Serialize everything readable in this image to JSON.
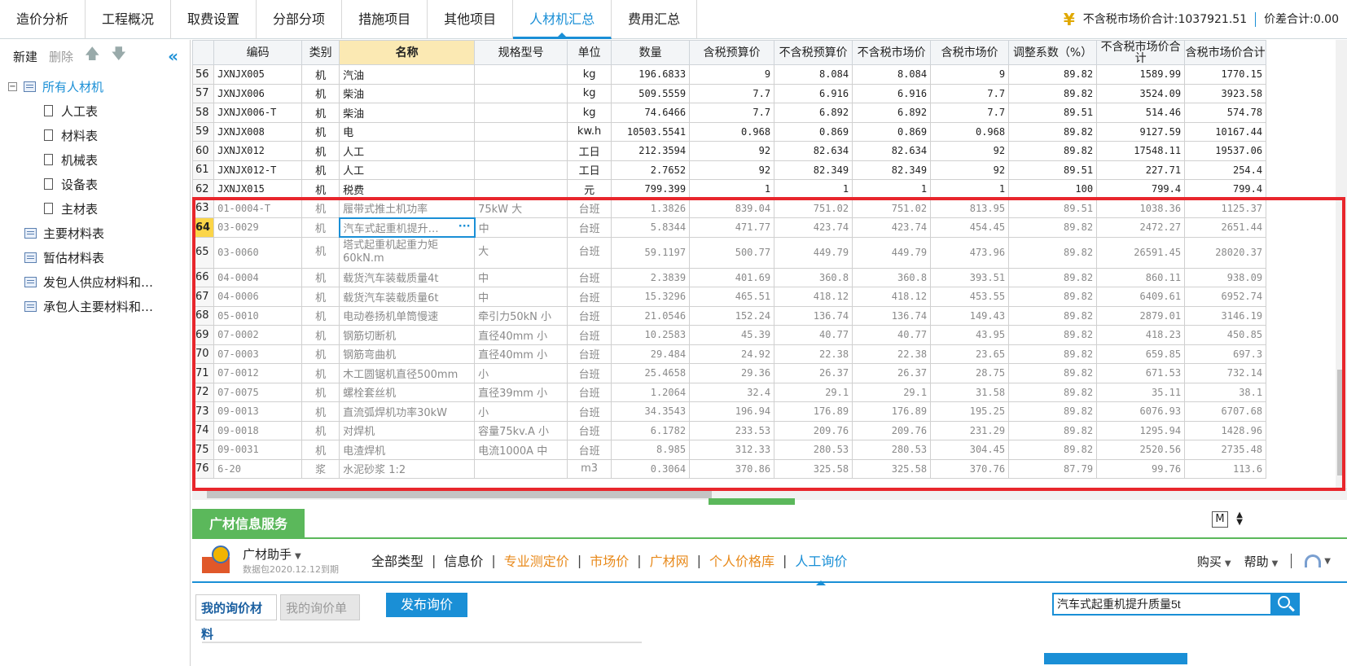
{
  "tabs": [
    "造价分析",
    "工程概况",
    "取费设置",
    "分部分项",
    "措施项目",
    "其他项目",
    "人材机汇总",
    "费用汇总"
  ],
  "active_tab": 6,
  "summary": {
    "market_total_label": "不含税市场价合计:1037921.51",
    "diff_total_label": "价差合计:0.00"
  },
  "left_toolbar": {
    "new": "新建",
    "delete": "删除"
  },
  "tree": {
    "root": "所有人材机",
    "children": [
      "人工表",
      "材料表",
      "机械表",
      "设备表",
      "主材表"
    ],
    "siblings": [
      "主要材料表",
      "暂估材料表",
      "发包人供应材料和…",
      "承包人主要材料和…"
    ]
  },
  "grid": {
    "headers": [
      "",
      "编码",
      "类别",
      "名称",
      "规格型号",
      "单位",
      "数量",
      "含税预算价",
      "不含税预算价",
      "不含税市场价",
      "含税市场价",
      "调整系数（%）",
      "不含税市场价合计",
      "含税市场价合计"
    ],
    "rows": [
      {
        "n": "56",
        "code": "JXNJX005",
        "type": "机",
        "name": "汽油",
        "spec": "",
        "unit": "kg",
        "qty": "196.6833",
        "p1": "9",
        "p2": "8.084",
        "p3": "8.084",
        "p4": "9",
        "coef": "89.82",
        "t1": "1589.99",
        "t2": "1770.15"
      },
      {
        "n": "57",
        "code": "JXNJX006",
        "type": "机",
        "name": "柴油",
        "spec": "",
        "unit": "kg",
        "qty": "509.5559",
        "p1": "7.7",
        "p2": "6.916",
        "p3": "6.916",
        "p4": "7.7",
        "coef": "89.82",
        "t1": "3524.09",
        "t2": "3923.58"
      },
      {
        "n": "58",
        "code": "JXNJX006-T",
        "type": "机",
        "name": "柴油",
        "spec": "",
        "unit": "kg",
        "qty": "74.6466",
        "p1": "7.7",
        "p2": "6.892",
        "p3": "6.892",
        "p4": "7.7",
        "coef": "89.51",
        "t1": "514.46",
        "t2": "574.78"
      },
      {
        "n": "59",
        "code": "JXNJX008",
        "type": "机",
        "name": "电",
        "spec": "",
        "unit": "kw.h",
        "qty": "10503.5541",
        "p1": "0.968",
        "p2": "0.869",
        "p3": "0.869",
        "p4": "0.968",
        "coef": "89.82",
        "t1": "9127.59",
        "t2": "10167.44"
      },
      {
        "n": "60",
        "code": "JXNJX012",
        "type": "机",
        "name": "人工",
        "spec": "",
        "unit": "工日",
        "qty": "212.3594",
        "p1": "92",
        "p2": "82.634",
        "p3": "82.634",
        "p4": "92",
        "coef": "89.82",
        "t1": "17548.11",
        "t2": "19537.06"
      },
      {
        "n": "61",
        "code": "JXNJX012-T",
        "type": "机",
        "name": "人工",
        "spec": "",
        "unit": "工日",
        "qty": "2.7652",
        "p1": "92",
        "p2": "82.349",
        "p3": "82.349",
        "p4": "92",
        "coef": "89.51",
        "t1": "227.71",
        "t2": "254.4"
      },
      {
        "n": "62",
        "code": "JXNJX015",
        "type": "机",
        "name": "税费",
        "spec": "",
        "unit": "元",
        "qty": "799.399",
        "p1": "1",
        "p2": "1",
        "p3": "1",
        "p4": "1",
        "coef": "100",
        "t1": "799.4",
        "t2": "799.4"
      },
      {
        "n": "63",
        "code": "01-0004-T",
        "type": "机",
        "name": "履带式推土机功率",
        "spec": "75kW 大",
        "unit": "台班",
        "qty": "1.3826",
        "p1": "839.04",
        "p2": "751.02",
        "p3": "751.02",
        "p4": "813.95",
        "coef": "89.51",
        "t1": "1038.36",
        "t2": "1125.37"
      },
      {
        "n": "64",
        "code": "03-0029",
        "type": "机",
        "name": "汽车式起重机提升…",
        "spec": "中",
        "unit": "台班",
        "qty": "5.8344",
        "p1": "471.77",
        "p2": "423.74",
        "p3": "423.74",
        "p4": "454.45",
        "coef": "89.82",
        "t1": "2472.27",
        "t2": "2651.44"
      },
      {
        "n": "65",
        "code": "03-0060",
        "type": "机",
        "name": "塔式起重机起重力矩60kN.m",
        "spec": "大",
        "unit": "台班",
        "qty": "59.1197",
        "p1": "500.77",
        "p2": "449.79",
        "p3": "449.79",
        "p4": "473.96",
        "coef": "89.82",
        "t1": "26591.45",
        "t2": "28020.37"
      },
      {
        "n": "66",
        "code": "04-0004",
        "type": "机",
        "name": "载货汽车装载质量4t",
        "spec": "中",
        "unit": "台班",
        "qty": "2.3839",
        "p1": "401.69",
        "p2": "360.8",
        "p3": "360.8",
        "p4": "393.51",
        "coef": "89.82",
        "t1": "860.11",
        "t2": "938.09"
      },
      {
        "n": "67",
        "code": "04-0006",
        "type": "机",
        "name": "载货汽车装载质量6t",
        "spec": "中",
        "unit": "台班",
        "qty": "15.3296",
        "p1": "465.51",
        "p2": "418.12",
        "p3": "418.12",
        "p4": "453.55",
        "coef": "89.82",
        "t1": "6409.61",
        "t2": "6952.74"
      },
      {
        "n": "68",
        "code": "05-0010",
        "type": "机",
        "name": "电动卷扬机单筒慢速",
        "spec": "牵引力50kN 小",
        "unit": "台班",
        "qty": "21.0546",
        "p1": "152.24",
        "p2": "136.74",
        "p3": "136.74",
        "p4": "149.43",
        "coef": "89.82",
        "t1": "2879.01",
        "t2": "3146.19"
      },
      {
        "n": "69",
        "code": "07-0002",
        "type": "机",
        "name": "钢筋切断机",
        "spec": "直径40mm 小",
        "unit": "台班",
        "qty": "10.2583",
        "p1": "45.39",
        "p2": "40.77",
        "p3": "40.77",
        "p4": "43.95",
        "coef": "89.82",
        "t1": "418.23",
        "t2": "450.85"
      },
      {
        "n": "70",
        "code": "07-0003",
        "type": "机",
        "name": "钢筋弯曲机",
        "spec": "直径40mm 小",
        "unit": "台班",
        "qty": "29.484",
        "p1": "24.92",
        "p2": "22.38",
        "p3": "22.38",
        "p4": "23.65",
        "coef": "89.82",
        "t1": "659.85",
        "t2": "697.3"
      },
      {
        "n": "71",
        "code": "07-0012",
        "type": "机",
        "name": "木工圆锯机直径500mm",
        "spec": "小",
        "unit": "台班",
        "qty": "25.4658",
        "p1": "29.36",
        "p2": "26.37",
        "p3": "26.37",
        "p4": "28.75",
        "coef": "89.82",
        "t1": "671.53",
        "t2": "732.14"
      },
      {
        "n": "72",
        "code": "07-0075",
        "type": "机",
        "name": "螺栓套丝机",
        "spec": "直径39mm 小",
        "unit": "台班",
        "qty": "1.2064",
        "p1": "32.4",
        "p2": "29.1",
        "p3": "29.1",
        "p4": "31.58",
        "coef": "89.82",
        "t1": "35.11",
        "t2": "38.1"
      },
      {
        "n": "73",
        "code": "09-0013",
        "type": "机",
        "name": "直流弧焊机功率30kW",
        "spec": "小",
        "unit": "台班",
        "qty": "34.3543",
        "p1": "196.94",
        "p2": "176.89",
        "p3": "176.89",
        "p4": "195.25",
        "coef": "89.82",
        "t1": "6076.93",
        "t2": "6707.68"
      },
      {
        "n": "74",
        "code": "09-0018",
        "type": "机",
        "name": "对焊机",
        "spec": "容量75kv.A 小",
        "unit": "台班",
        "qty": "6.1782",
        "p1": "233.53",
        "p2": "209.76",
        "p3": "209.76",
        "p4": "231.29",
        "coef": "89.82",
        "t1": "1295.94",
        "t2": "1428.96"
      },
      {
        "n": "75",
        "code": "09-0031",
        "type": "机",
        "name": "电渣焊机",
        "spec": "电流1000A 中",
        "unit": "台班",
        "qty": "8.985",
        "p1": "312.33",
        "p2": "280.53",
        "p3": "280.53",
        "p4": "304.45",
        "coef": "89.82",
        "t1": "2520.56",
        "t2": "2735.48"
      },
      {
        "n": "76",
        "code": "6-20",
        "type": "浆",
        "name": "水泥砂浆 1:2",
        "spec": "",
        "unit": "m3",
        "qty": "0.3064",
        "p1": "370.86",
        "p2": "325.58",
        "p3": "325.58",
        "p4": "370.76",
        "coef": "87.79",
        "t1": "99.76",
        "t2": "113.6"
      }
    ]
  },
  "info": {
    "title": "广材信息服务",
    "m_label": "M",
    "brand_name": "广材助手",
    "brand_sub": "数据包2020.12.12到期",
    "nav": [
      "全部类型",
      "信息价",
      "专业测定价",
      "市场价",
      "广材网",
      "个人价格库",
      "人工询价"
    ],
    "buy": "购买",
    "help": "帮助",
    "subtab1": "我的询价材料",
    "subtab2": "我的询价单",
    "publish": "发布询价",
    "search_value": "汽车式起重机提升质量5t"
  },
  "colors": {
    "accent": "#1a8fd6",
    "highlight": "#e8262c",
    "green": "#5bb85b"
  }
}
